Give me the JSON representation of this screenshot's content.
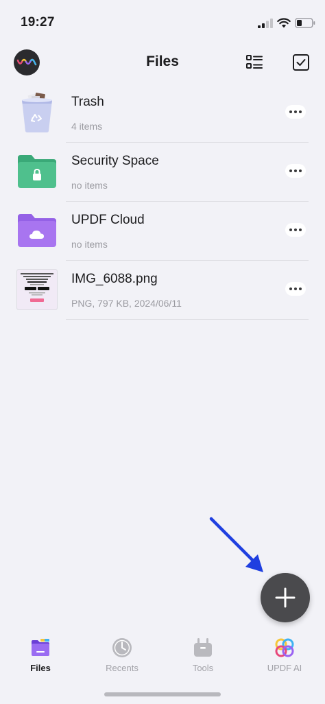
{
  "status_bar": {
    "time": "19:27"
  },
  "header": {
    "title": "Files"
  },
  "files": [
    {
      "name": "Trash",
      "meta": "4 items",
      "icon": "trash-icon"
    },
    {
      "name": "Security Space",
      "meta": "no items",
      "icon": "lock-folder-icon"
    },
    {
      "name": "UPDF Cloud",
      "meta": "no items",
      "icon": "cloud-folder-icon"
    },
    {
      "name": "IMG_6088.png",
      "meta": "PNG, 797 KB, 2024/06/11",
      "icon": "image-thumbnail"
    }
  ],
  "tabs": [
    {
      "label": "Files",
      "active": true
    },
    {
      "label": "Recents",
      "active": false
    },
    {
      "label": "Tools",
      "active": false
    },
    {
      "label": "UPDF AI",
      "active": false
    }
  ],
  "colors": {
    "background": "#f2f2f7",
    "security_folder": "#4fc08d",
    "cloud_folder": "#a875f0",
    "fab": "#4a4a4d",
    "annotation_arrow": "#1f3fe0"
  }
}
